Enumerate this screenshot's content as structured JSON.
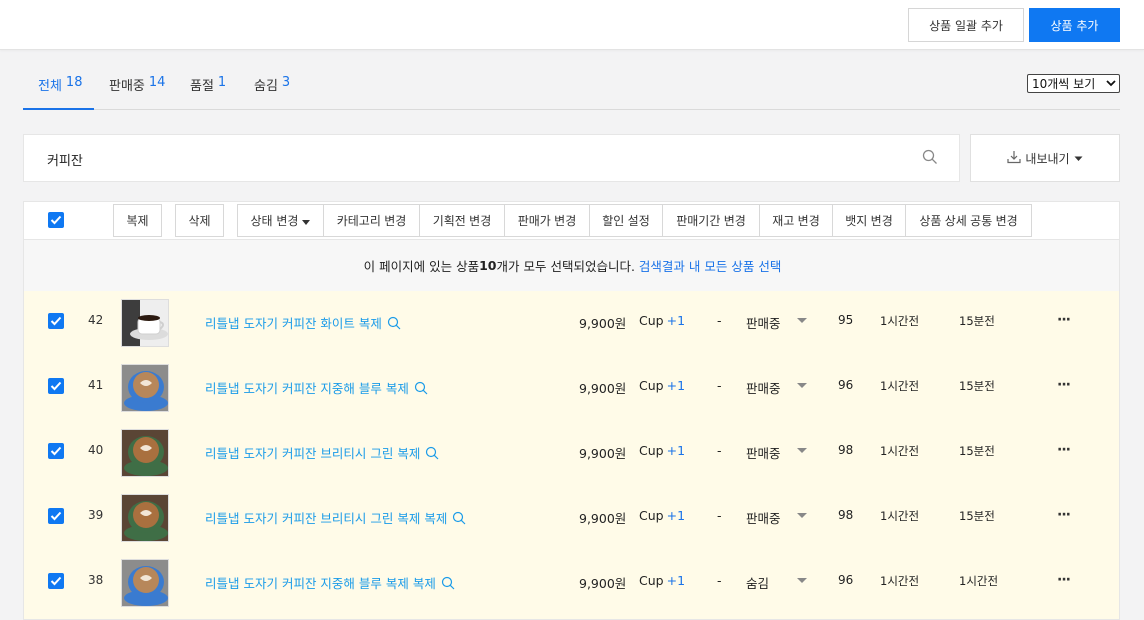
{
  "header": {
    "bulk_add_label": "상품 일괄 추가",
    "add_label": "상품 추가"
  },
  "tabs": [
    {
      "label": "전체",
      "count": "18"
    },
    {
      "label": "판매중",
      "count": "14"
    },
    {
      "label": "품절",
      "count": "1"
    },
    {
      "label": "숨김",
      "count": "3"
    }
  ],
  "page_size_select": {
    "value": "10개씩 보기"
  },
  "search": {
    "value": "커피잔"
  },
  "export": {
    "label": "내보내기"
  },
  "toolbar": {
    "copy": "복제",
    "delete": "삭제",
    "status_change": "상태 변경",
    "category_change": "카테고리 변경",
    "promo_change": "기획전 변경",
    "price_change": "판매가 변경",
    "discount_setting": "할인 설정",
    "period_change": "판매기간 변경",
    "stock_change": "재고 변경",
    "badge_change": "뱃지 변경",
    "detail_common_change": "상품 상세 공통 변경"
  },
  "notice": {
    "before": "이 페이지에 있는 상품 ",
    "count": "10",
    "after": "개가 모두 선택되었습니다.",
    "link": "검색결과 내 모든 상품 선택"
  },
  "products": [
    {
      "num": "42",
      "name": "리틀냅 도자기 커피잔 화이트 복제",
      "price": "9,900원",
      "option": "Cup",
      "option_more": "+1",
      "dash": "-",
      "status": "판매중",
      "stock": "95",
      "created": "1시간전",
      "updated": "15분전",
      "thumb_color": "#f2f2f2",
      "cup_color": "#ffffff"
    },
    {
      "num": "41",
      "name": "리틀냅 도자기 커피잔 지중해 블루 복제",
      "price": "9,900원",
      "option": "Cup",
      "option_more": "+1",
      "dash": "-",
      "status": "판매중",
      "stock": "96",
      "created": "1시간전",
      "updated": "15분전",
      "thumb_color": "#8a8a8a",
      "cup_color": "#3a7bd0"
    },
    {
      "num": "40",
      "name": "리틀냅 도자기 커피잔 브리티시 그린 복제",
      "price": "9,900원",
      "option": "Cup",
      "option_more": "+1",
      "dash": "-",
      "status": "판매중",
      "stock": "98",
      "created": "1시간전",
      "updated": "15분전",
      "thumb_color": "#5a4535",
      "cup_color": "#3f6e46"
    },
    {
      "num": "39",
      "name": "리틀냅 도자기 커피잔 브리티시 그린 복제 복제",
      "price": "9,900원",
      "option": "Cup",
      "option_more": "+1",
      "dash": "-",
      "status": "판매중",
      "stock": "98",
      "created": "1시간전",
      "updated": "15분전",
      "thumb_color": "#5a4535",
      "cup_color": "#3f6e46"
    },
    {
      "num": "38",
      "name": "리틀냅 도자기 커피잔 지중해 블루 복제 복제",
      "price": "9,900원",
      "option": "Cup",
      "option_more": "+1",
      "dash": "-",
      "status": "숨김",
      "stock": "96",
      "created": "1시간전",
      "updated": "1시간전",
      "thumb_color": "#8a8a8a",
      "cup_color": "#3a7bd0"
    }
  ]
}
